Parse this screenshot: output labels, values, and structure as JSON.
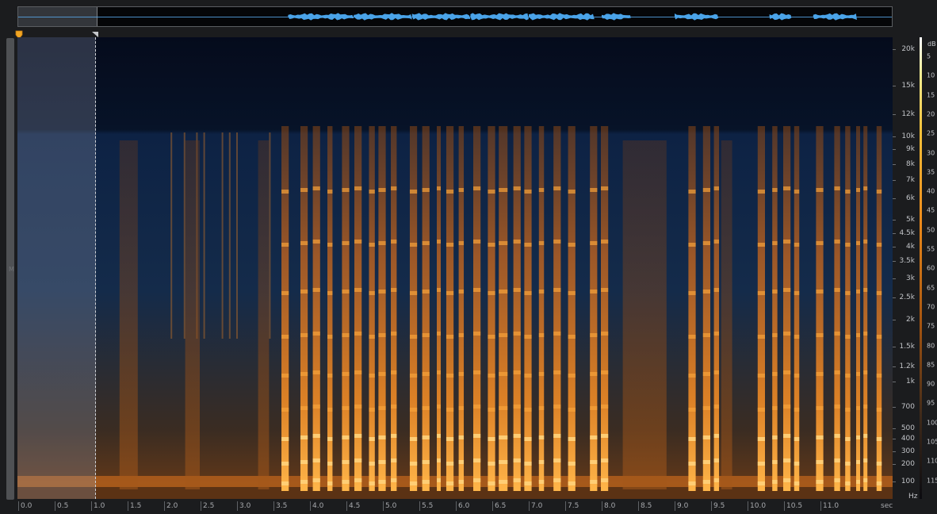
{
  "rail": {
    "label": "M"
  },
  "colors": {
    "background": "#061025",
    "low_energy": "#1a3050",
    "high_energy": "#f5a030",
    "peak": "#ffe08a",
    "waveform": "#4aa3e8",
    "selection": "#a0aac0"
  },
  "overview": {
    "waveform_icon": "waveform-overview",
    "speech_segments_sec": [
      [
        3.7,
        4.6
      ],
      [
        4.6,
        5.4
      ],
      [
        5.4,
        6.2
      ],
      [
        6.2,
        7.0
      ],
      [
        7.0,
        7.9
      ],
      [
        8.0,
        8.4
      ],
      [
        9.0,
        9.6
      ],
      [
        10.3,
        10.6
      ],
      [
        10.9,
        11.5
      ]
    ]
  },
  "selection": {
    "start_sec": 0.0,
    "end_sec": 1.0
  },
  "playhead": {
    "position_sec": 0.0,
    "icon": "playhead-marker"
  },
  "frequency_axis": {
    "unit": "Hz",
    "labels": [
      "20k",
      "15k",
      "12k",
      "10k",
      "9k",
      "8k",
      "7k",
      "6k",
      "5k",
      "4.5k",
      "4k",
      "3.5k",
      "3k",
      "2.5k",
      "2k",
      "1.5k",
      "1.2k",
      "1k",
      "700",
      "500",
      "400",
      "300",
      "200",
      "100"
    ]
  },
  "db_scale": {
    "unit": "dB",
    "labels": [
      "5",
      "10",
      "15",
      "20",
      "25",
      "30",
      "35",
      "40",
      "45",
      "50",
      "55",
      "60",
      "65",
      "70",
      "75",
      "80",
      "85",
      "90",
      "95",
      "100",
      "105",
      "110",
      "115"
    ]
  },
  "time_axis": {
    "unit": "sec",
    "labels": [
      "0.0",
      "0.5",
      "1.0",
      "1.5",
      "2.0",
      "2.5",
      "3.0",
      "3.5",
      "4.0",
      "4.5",
      "5.0",
      "5.5",
      "6.0",
      "6.5",
      "7.0",
      "7.5",
      "8.0",
      "8.5",
      "9.0",
      "9.5",
      "10.0",
      "10.5",
      "11.0"
    ],
    "total_sec": 12.0
  },
  "spectrogram": {
    "bursts_sec": [
      [
        3.62,
        3.72
      ],
      [
        3.88,
        3.98
      ],
      [
        4.05,
        4.15
      ],
      [
        4.25,
        4.32
      ],
      [
        4.45,
        4.55
      ],
      [
        4.62,
        4.72
      ],
      [
        4.82,
        4.9
      ],
      [
        4.95,
        5.05
      ],
      [
        5.12,
        5.2
      ],
      [
        5.38,
        5.48
      ],
      [
        5.55,
        5.65
      ],
      [
        5.75,
        5.8
      ],
      [
        5.88,
        5.98
      ],
      [
        6.05,
        6.12
      ],
      [
        6.25,
        6.35
      ],
      [
        6.45,
        6.55
      ],
      [
        6.6,
        6.72
      ],
      [
        6.8,
        6.9
      ],
      [
        6.95,
        7.05
      ],
      [
        7.15,
        7.22
      ],
      [
        7.35,
        7.45
      ],
      [
        7.55,
        7.65
      ],
      [
        7.85,
        7.95
      ],
      [
        8.0,
        8.1
      ],
      [
        9.2,
        9.3
      ],
      [
        9.4,
        9.5
      ],
      [
        9.55,
        9.62
      ],
      [
        10.15,
        10.25
      ],
      [
        10.35,
        10.42
      ],
      [
        10.5,
        10.6
      ],
      [
        10.65,
        10.72
      ],
      [
        10.95,
        11.05
      ],
      [
        11.2,
        11.28
      ],
      [
        11.35,
        11.42
      ],
      [
        11.5,
        11.55
      ],
      [
        11.6,
        11.65
      ],
      [
        11.78,
        11.85
      ]
    ],
    "faint_sec": [
      [
        1.4,
        1.65
      ],
      [
        2.3,
        2.5
      ],
      [
        3.3,
        3.45
      ],
      [
        8.3,
        8.9
      ],
      [
        9.65,
        9.8
      ]
    ],
    "onset_lines_sec": [
      2.1,
      2.28,
      2.45,
      2.55,
      2.8,
      2.9,
      3.0,
      3.45
    ]
  }
}
